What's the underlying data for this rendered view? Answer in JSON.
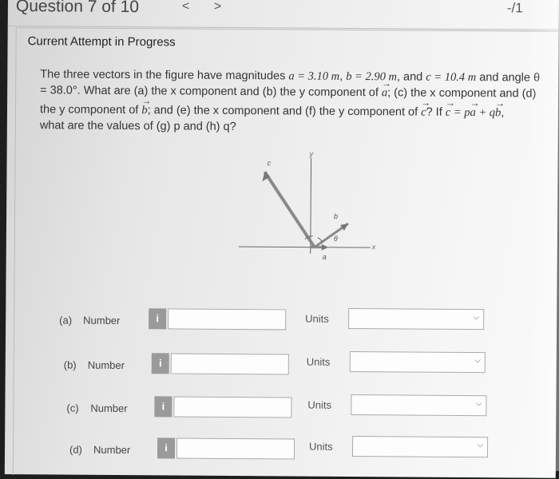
{
  "header": {
    "question_counter": "Question 7 of 10",
    "prev_icon": "<",
    "next_icon": ">",
    "score": "-/1"
  },
  "section_title": "Current Attempt in Progress",
  "problem": {
    "line1a": "The three vectors in the figure have magnitudes ",
    "a_eq": "a = 3.10 m",
    "sep1": ", ",
    "b_eq": "b = 2.90 m",
    "sep2": ", and ",
    "c_eq": "c = 10.4 m",
    "line1b": " and angle θ",
    "line2": "= 38.0°. What are (a) the x component and (b) the y component of ",
    "vec_a": "a",
    "line2b": "; (c) the x component and (d)",
    "line3a": "the y component of ",
    "vec_b": "b",
    "line3b": "; and (e) the x component and (f) the y component of ",
    "vec_c": "c",
    "line3c": "? If ",
    "vec_c2": "c",
    "eq_p": " = p",
    "vec_a2": "a",
    "eq_q": " + q",
    "vec_b2": "b",
    "line3d": ",",
    "line4": "what are the values of (g) p and (h) q?"
  },
  "diagram": {
    "x_label": "x",
    "y_label": "y",
    "c_label": "c",
    "b_label": "b",
    "a_label": "a",
    "theta_label": "θ"
  },
  "answers": [
    {
      "letter": "(a)",
      "label": "Number",
      "info": "i",
      "value": "",
      "units_label": "Units",
      "units_value": ""
    },
    {
      "letter": "(b)",
      "label": "Number",
      "info": "i",
      "value": "",
      "units_label": "Units",
      "units_value": ""
    },
    {
      "letter": "(c)",
      "label": "Number",
      "info": "i",
      "value": "",
      "units_label": "Units",
      "units_value": ""
    },
    {
      "letter": "(d)",
      "label": "Number",
      "info": "i",
      "value": "",
      "units_label": "Units",
      "units_value": ""
    }
  ]
}
